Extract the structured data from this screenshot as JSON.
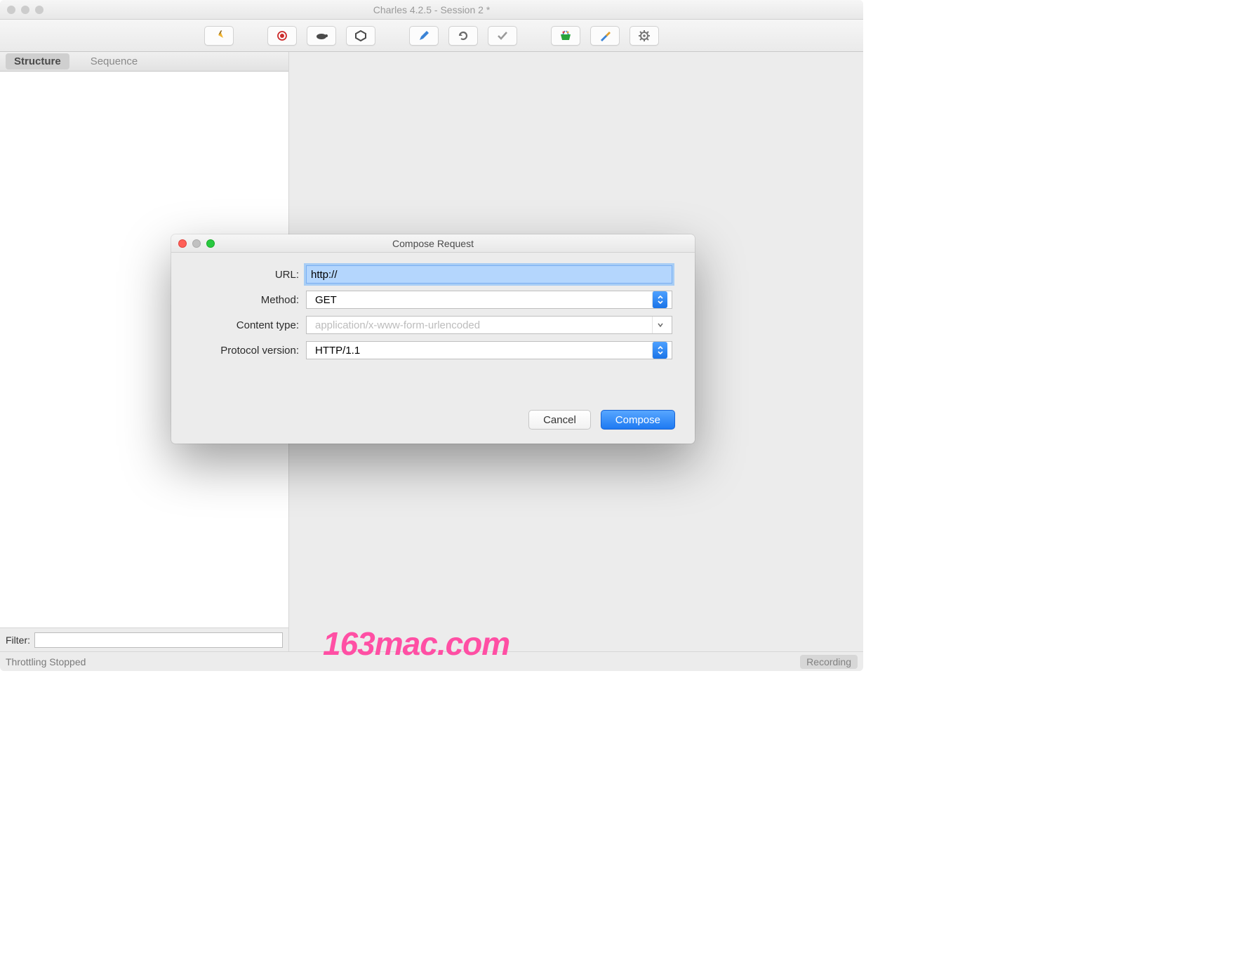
{
  "window": {
    "title": "Charles 4.2.5 - Session 2 *"
  },
  "tabs": {
    "items": [
      "Structure",
      "Sequence"
    ],
    "activeIndex": 0
  },
  "filter": {
    "label": "Filter:",
    "value": ""
  },
  "status": {
    "left": "Throttling Stopped",
    "right": "Recording"
  },
  "dialog": {
    "title": "Compose Request",
    "labels": {
      "url": "URL:",
      "method": "Method:",
      "contentType": "Content type:",
      "protocol": "Protocol version:"
    },
    "values": {
      "url": "http://",
      "method": "GET",
      "contentTypePlaceholder": "application/x-www-form-urlencoded",
      "contentType": "",
      "protocol": "HTTP/1.1"
    },
    "buttons": {
      "cancel": "Cancel",
      "compose": "Compose"
    }
  },
  "watermark": "163mac.com",
  "toolbar_icons": [
    "broom",
    "record",
    "turtle",
    "target",
    "pencil",
    "reload",
    "checkmark",
    "basket",
    "tools",
    "gear"
  ],
  "colors": {
    "accent": "#1e7af2",
    "focusRing": "#a7cdf5",
    "pink": "#ff4fa4"
  }
}
